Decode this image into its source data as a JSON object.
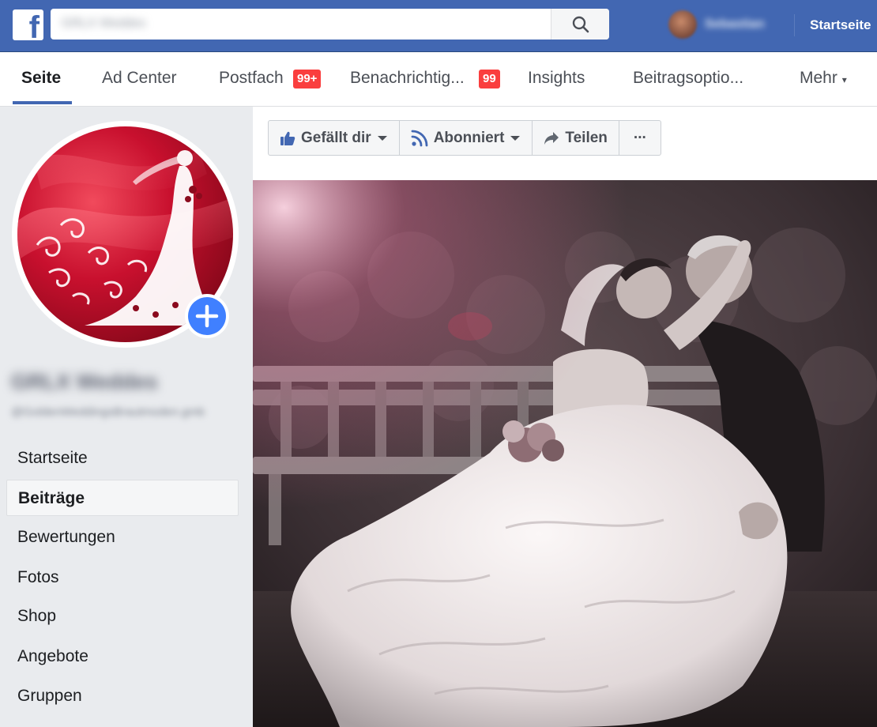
{
  "topbar": {
    "search_value": "GRLX Weddes",
    "user_name": "Sebastian",
    "home_label": "Startseite"
  },
  "subnav": {
    "items": [
      {
        "label": "Seite"
      },
      {
        "label": "Ad Center"
      },
      {
        "label": "Postfach",
        "badge": "99+"
      },
      {
        "label": "Benachrichtig...",
        "badge": "99"
      },
      {
        "label": "Insights"
      },
      {
        "label": "Beitragsoptio..."
      },
      {
        "label": "Mehr",
        "caret": "▾"
      }
    ]
  },
  "sidebar": {
    "page_name": "GRLX Weddes",
    "page_handle": "@GoldenWeddingsBrautmoden.gmb",
    "items": [
      {
        "label": "Startseite"
      },
      {
        "label": "Beiträge"
      },
      {
        "label": "Bewertungen"
      },
      {
        "label": "Fotos"
      },
      {
        "label": "Shop"
      },
      {
        "label": "Angebote"
      },
      {
        "label": "Gruppen"
      }
    ]
  },
  "actions": {
    "like_label": "Gefällt dir",
    "follow_label": "Abonniert",
    "share_label": "Teilen",
    "more_label": "···"
  },
  "colors": {
    "brand": "#4267b2",
    "badge": "#fa3e3e",
    "plus": "#4080ff"
  }
}
